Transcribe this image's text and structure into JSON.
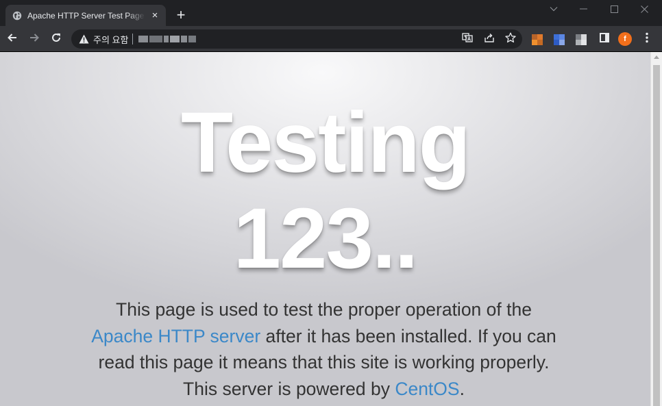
{
  "tab": {
    "title": "Apache HTTP Server Test Page powered by CentOS",
    "close_glyph": "×"
  },
  "new_tab_glyph": "+",
  "omnibox": {
    "security_label": "주의 요함"
  },
  "profile": {
    "initial": "f",
    "color": "#f26f1b"
  },
  "icons": {
    "favicon": "globe-icon",
    "back": "back-arrow-icon",
    "forward": "forward-arrow-icon",
    "reload": "reload-icon",
    "warning": "warning-triangle-icon",
    "translate": "translate-icon",
    "share": "share-icon",
    "bookmark": "star-icon",
    "side_panel": "side-panel-icon",
    "menu": "kebab-menu-icon"
  },
  "page": {
    "heading_line1": "Testing",
    "heading_line2": "123..",
    "description": {
      "line1": "This page is used to test the proper operation of the",
      "link1": "Apache HTTP server",
      "line2_rest": " after it has been installed. If you can",
      "line3": "read this page it means that this site is working properly.",
      "line4_prefix": "This server is powered by ",
      "link2": "CentOS",
      "line4_suffix": "."
    }
  },
  "colors": {
    "chrome_dark": "#202124",
    "toolbar": "#35363a",
    "link": "#3b88c8",
    "body_text": "#333333"
  }
}
